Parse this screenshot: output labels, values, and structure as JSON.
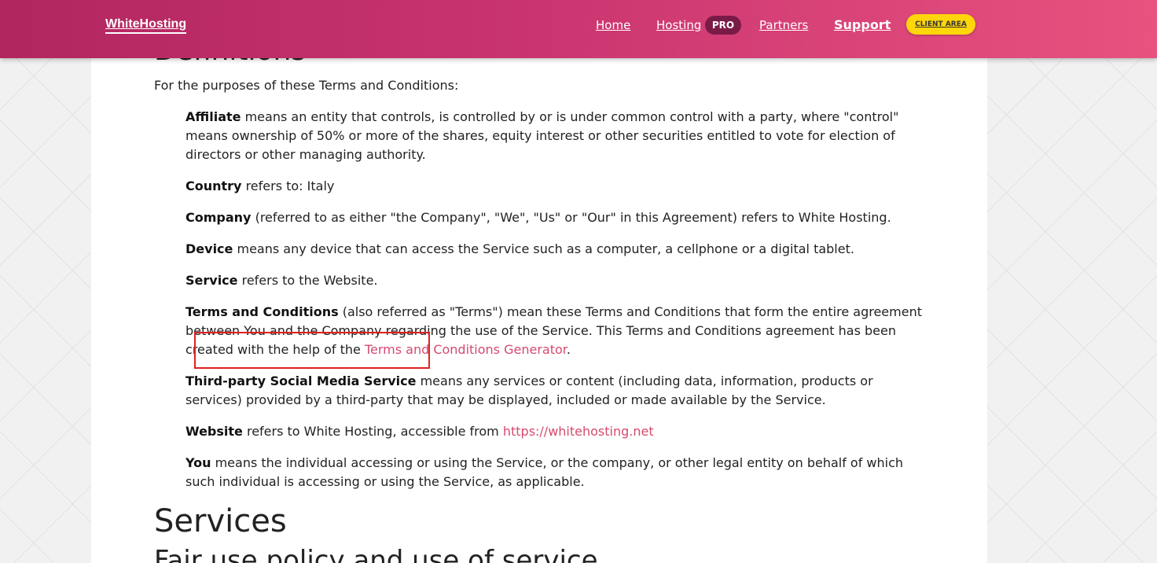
{
  "header": {
    "logo": "WhiteHosting",
    "nav": {
      "home": "Home",
      "hosting": "Hosting",
      "pro_badge": "PRO",
      "partners": "Partners",
      "support": "Support",
      "client_area": "CLIENT AREA"
    },
    "colors": {
      "gradient_start": "#b1265f",
      "gradient_end": "#e8527f",
      "client_button": "#ffd60a",
      "pro_badge": "#7a1a47"
    }
  },
  "content": {
    "section_title": "Definitions",
    "intro": "For the purposes of these Terms and Conditions:",
    "definitions": [
      {
        "term": "Affiliate",
        "text": " means an entity that controls, is controlled by or is under common control with a party, where \"control\" means ownership of 50% or more of the shares, equity interest or other securities entitled to vote for election of directors or other managing authority."
      },
      {
        "term": "Country",
        "text": " refers to: Italy"
      },
      {
        "term": "Company",
        "text": " (referred to as either \"the Company\", \"We\", \"Us\" or \"Our\" in this Agreement) refers to White Hosting."
      },
      {
        "term": "Device",
        "text": " means any device that can access the Service such as a computer, a cellphone or a digital tablet."
      },
      {
        "term": "Service",
        "text": " refers to the Website."
      },
      {
        "term": "Terms and Conditions",
        "text": " (also referred as \"Terms\") mean these Terms and Conditions that form the entire agreement between You and the Company regarding the use of the Service. This Terms and Conditions agreement has been created with the help of the ",
        "link": "Terms and Conditions Generator",
        "after": "."
      },
      {
        "term": "Third-party Social Media Service",
        "text": " means any services or content (including data, information, products or services) provided by a third-party that may be displayed, included or made available by the Service."
      },
      {
        "term": "Website",
        "text": " refers to White Hosting, accessible from ",
        "link": "https://whitehosting.net"
      },
      {
        "term": "You",
        "text": " means the individual accessing or using the Service, or the company, or other legal entity on behalf of which such individual is accessing or using the Service, as applicable."
      }
    ],
    "services_title": "Services",
    "fair_use_title": "Fair use policy and use of service",
    "link_color": "#d64a6f"
  }
}
